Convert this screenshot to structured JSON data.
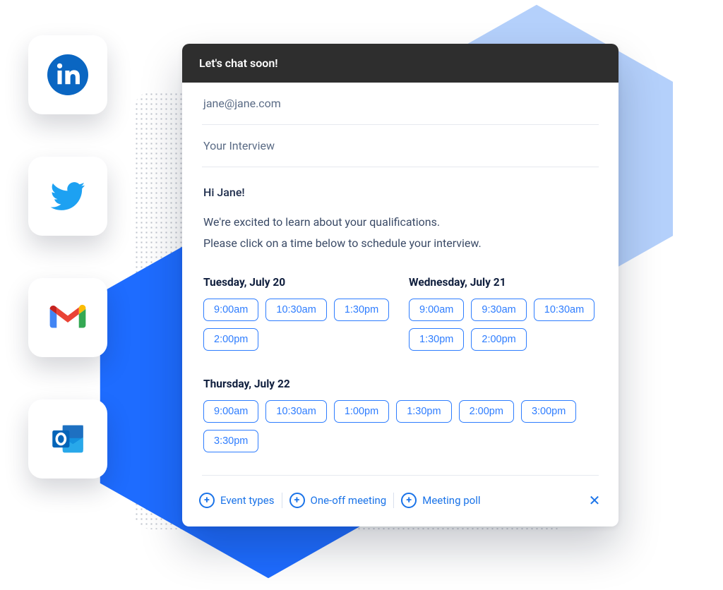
{
  "social_apps": [
    {
      "name": "linkedin"
    },
    {
      "name": "twitter"
    },
    {
      "name": "gmail"
    },
    {
      "name": "outlook"
    }
  ],
  "email": {
    "header_title": "Let's chat soon!",
    "recipient": "jane@jane.com",
    "subject": "Your Interview",
    "greeting": "Hi Jane!",
    "body_line_1": "We're excited to learn about your qualifications.",
    "body_line_2": "Please click on a time below to schedule your interview.",
    "days": [
      {
        "label": "Tuesday, July 20",
        "slots": [
          "9:00am",
          "10:30am",
          "1:30pm",
          "2:00pm"
        ]
      },
      {
        "label": "Wednesday, July 21",
        "slots": [
          "9:00am",
          "9:30am",
          "10:30am",
          "1:30pm",
          "2:00pm"
        ]
      },
      {
        "label": "Thursday, July 22",
        "slots": [
          "9:00am",
          "10:30am",
          "1:00pm",
          "1:30pm",
          "2:00pm",
          "3:00pm",
          "3:30pm"
        ]
      }
    ]
  },
  "footer_actions": [
    "Event types",
    "One-off meeting",
    "Meeting poll"
  ]
}
